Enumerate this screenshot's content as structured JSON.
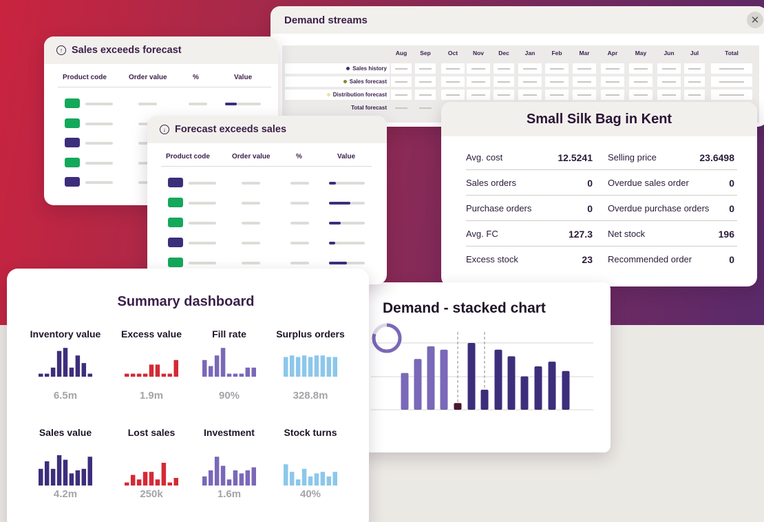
{
  "colors": {
    "navy": "#3d2e7c",
    "purple": "#7a68b8",
    "red": "#d42a36",
    "lightblue": "#8cc7ea",
    "green": "#14a85a",
    "olive": "#7c8c2a",
    "cream": "#e8e3a8",
    "maroon": "#4a1630"
  },
  "demand_streams": {
    "title": "Demand streams",
    "close_icon": "close-icon",
    "months": [
      "Aug",
      "Sep",
      "Oct",
      "Nov",
      "Dec",
      "Jan",
      "Feb",
      "Mar",
      "Apr",
      "May",
      "Jun",
      "Jul",
      "Total"
    ],
    "rows": [
      {
        "label": "Sales history",
        "dot": "#3d2e7c"
      },
      {
        "label": "Sales forecast",
        "dot": "#7c8c2a"
      },
      {
        "label": "Distribution forecast",
        "dot": "#e8e3a8"
      },
      {
        "label": "Total forecast",
        "dot": null
      }
    ]
  },
  "sales_exceeds": {
    "title": "Sales exceeds forecast",
    "icon": "arrow-up-circle-icon",
    "headers": [
      "Product code",
      "Order value",
      "%",
      "Value"
    ],
    "rows": [
      {
        "color": "#14a85a",
        "fill": 0.33
      },
      {
        "color": "#14a85a",
        "fill": 0
      },
      {
        "color": "#3d2e7c",
        "fill": 0
      },
      {
        "color": "#14a85a",
        "fill": 0
      },
      {
        "color": "#3d2e7c",
        "fill": 0
      }
    ]
  },
  "forecast_exceeds": {
    "title": "Forecast exceeds sales",
    "icon": "arrow-down-circle-icon",
    "headers": [
      "Product code",
      "Order value",
      "%",
      "Value"
    ],
    "rows": [
      {
        "color": "#3d2e7c",
        "fill": 0.2
      },
      {
        "color": "#14a85a",
        "fill": 0.6
      },
      {
        "color": "#14a85a",
        "fill": 0.33
      },
      {
        "color": "#3d2e7c",
        "fill": 0.17
      },
      {
        "color": "#14a85a",
        "fill": 0.5
      }
    ]
  },
  "silk_bag": {
    "title": "Small Silk Bag in Kent",
    "rows": [
      {
        "l1": "Avg. cost",
        "v1": "12.5241",
        "l2": "Selling price",
        "v2": "23.6498"
      },
      {
        "l1": "Sales orders",
        "v1": "0",
        "l2": "Overdue sales order",
        "v2": "0"
      },
      {
        "l1": "Purchase orders",
        "v1": "0",
        "l2": "Overdue purchase orders",
        "v2": "0"
      },
      {
        "l1": "Avg. FC",
        "v1": "127.3",
        "l2": "Net stock",
        "v2": "196"
      },
      {
        "l1": "Excess stock",
        "v1": "23",
        "l2": "Recommended order",
        "v2": "0"
      }
    ]
  },
  "stacked": {
    "title": "Demand - stacked chart",
    "donut_fill": 0.8
  },
  "summary": {
    "title": "Summary  dashboard",
    "metrics": [
      {
        "label": "Inventory value",
        "value": "6.5m",
        "color": "#3d2e7c",
        "bars": [
          0.1,
          0.1,
          0.3,
          0.85,
          0.95,
          0.3,
          0.7,
          0.45,
          0.1
        ]
      },
      {
        "label": "Excess value",
        "value": "1.9m",
        "color": "#d42a36",
        "bars": [
          0.1,
          0.1,
          0.1,
          0.1,
          0.4,
          0.4,
          0.1,
          0.1,
          0.55
        ]
      },
      {
        "label": "Fill rate",
        "value": "90%",
        "color": "#7a68b8",
        "bars": [
          0.55,
          0.35,
          0.7,
          0.95,
          0.1,
          0.1,
          0.1,
          0.3,
          0.3
        ]
      },
      {
        "label": "Surplus orders",
        "value": "328.8m",
        "color": "#8cc7ea",
        "bars": [
          0.65,
          0.7,
          0.65,
          0.7,
          0.65,
          0.7,
          0.7,
          0.65,
          0.65
        ]
      },
      {
        "label": "Sales value",
        "value": "4.2m",
        "color": "#3d2e7c",
        "bars": [
          0.55,
          0.8,
          0.55,
          1.0,
          0.85,
          0.4,
          0.5,
          0.55,
          0.95
        ]
      },
      {
        "label": "Lost sales",
        "value": "250k",
        "color": "#d42a36",
        "bars": [
          0.1,
          0.35,
          0.2,
          0.45,
          0.45,
          0.2,
          0.75,
          0.1,
          0.25
        ]
      },
      {
        "label": "Investment",
        "value": "1.6m",
        "color": "#7a68b8",
        "bars": [
          0.3,
          0.5,
          0.95,
          0.65,
          0.2,
          0.5,
          0.4,
          0.5,
          0.6
        ]
      },
      {
        "label": "Stock turns",
        "value": "40%",
        "color": "#8cc7ea",
        "bars": [
          0.7,
          0.45,
          0.2,
          0.55,
          0.3,
          0.4,
          0.45,
          0.3,
          0.45
        ]
      }
    ]
  },
  "chart_data": {
    "type": "bar",
    "title": "Demand - stacked chart",
    "series": [
      {
        "values": [
          0.55,
          0.76,
          0.95,
          0.9,
          0.1,
          1.0,
          0.3,
          0.9,
          0.8,
          0.5,
          0.65,
          0.72,
          0.58
        ]
      }
    ],
    "bar_colors": [
      "#7a68b8",
      "#7a68b8",
      "#7a68b8",
      "#7a68b8",
      "#4a1630",
      "#3d2e7c",
      "#3d2e7c",
      "#3d2e7c",
      "#3d2e7c",
      "#3d2e7c",
      "#3d2e7c",
      "#3d2e7c",
      "#3d2e7c"
    ],
    "markers_at": [
      4,
      6
    ],
    "grid": true
  }
}
